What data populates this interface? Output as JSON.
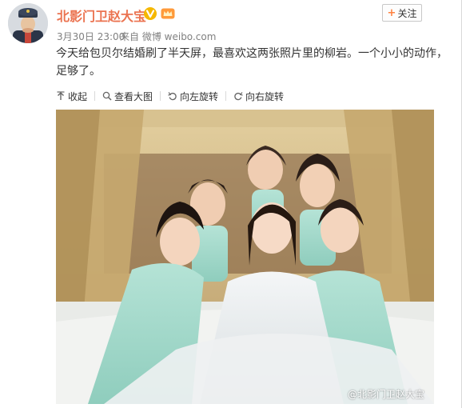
{
  "post": {
    "author": "北影门卫赵大宝",
    "follow_label": "关注",
    "timestamp": "3月30日 23:00",
    "source_prefix": "来自",
    "source": "微博 weibo.com",
    "text": "今天给包贝尔结婚刷了半天屏，最喜欢这两张照片里的柳岩。一个小小的动作，足够了。"
  },
  "actions": [
    {
      "label": "收起",
      "icon": "collapse-icon"
    },
    {
      "label": "查看大图",
      "icon": "magnifier-icon"
    },
    {
      "label": "向左旋转",
      "icon": "rotate-left-icon"
    },
    {
      "label": "向右旋转",
      "icon": "rotate-right-icon"
    }
  ],
  "photo": {
    "watermark": "@北影门卫赵大宝"
  },
  "colors": {
    "username": "#eb7350",
    "follow_plus": "#ff8140",
    "meta": "#808080",
    "verified": "#f5b800"
  }
}
